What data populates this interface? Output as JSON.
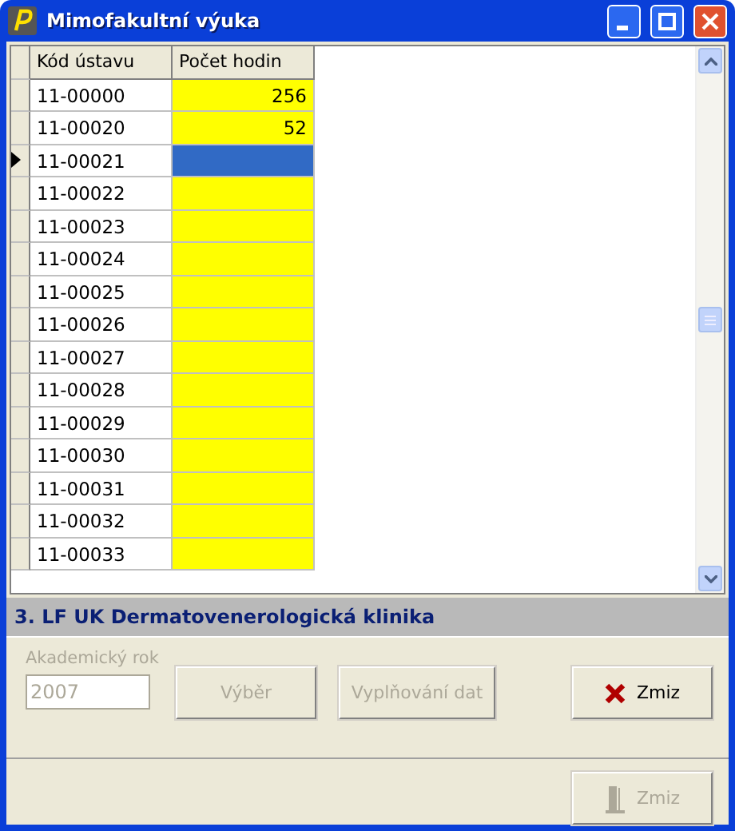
{
  "window": {
    "title": "Mimofakultní výuka"
  },
  "table": {
    "columns": [
      "Kód ústavu",
      "Počet hodin"
    ],
    "rows": [
      {
        "code": "11-00000",
        "hours": "256",
        "current": false
      },
      {
        "code": "11-00020",
        "hours": "52",
        "current": false
      },
      {
        "code": "11-00021",
        "current": true
      },
      {
        "code": "11-00022",
        "current": false
      },
      {
        "code": "11-00023",
        "current": false
      },
      {
        "code": "11-00024",
        "current": false
      },
      {
        "code": "11-00025",
        "current": false
      },
      {
        "code": "11-00026",
        "current": false
      },
      {
        "code": "11-00027",
        "current": false
      },
      {
        "code": "11-00028",
        "current": false
      },
      {
        "code": "11-00029",
        "current": false
      },
      {
        "code": "11-00030",
        "current": false
      },
      {
        "code": "11-00031",
        "current": false
      },
      {
        "code": "11-00032",
        "current": false
      },
      {
        "code": "11-00033",
        "current": false
      }
    ]
  },
  "department": "3. LF UK Dermatovenerologická klinika",
  "year": {
    "label": "Akademický rok",
    "value": "2007",
    "disabled": true
  },
  "buttons": [
    {
      "kind": "select",
      "label": "Výběr",
      "disabled": true
    },
    {
      "kind": "fill",
      "label": "Vyplňování dat",
      "disabled": true
    },
    {
      "kind": "close",
      "label": "Zmiz",
      "disabled": false
    }
  ],
  "footer_button": {
    "label": "Zmiz",
    "disabled": true
  }
}
